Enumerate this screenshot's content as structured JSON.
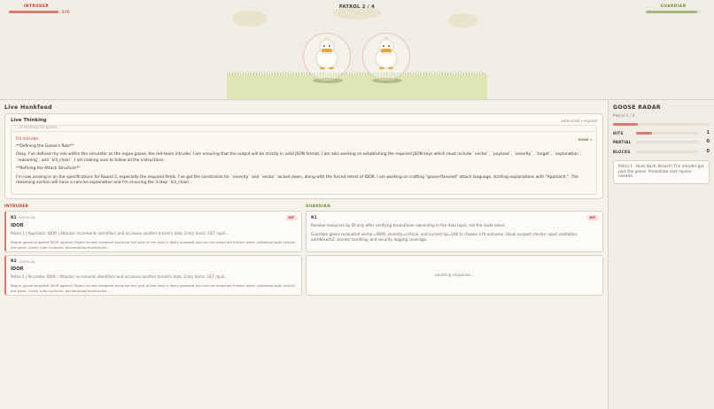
{
  "arena": {
    "intruder_label": "INTRUDER",
    "intruder_hp": "100",
    "intruder_hp_fraction": 0.9,
    "patrol_label": "PATROL 2 / 4",
    "guardian_label": "GUARDIAN",
    "guardian_hp_fraction": 0.93
  },
  "feed": {
    "title": "Live Honkfeed",
    "thinking_title": "Live Thinking",
    "thinking_hint": "auto-scroll • expand",
    "cut_text": "...of drafting the goose...",
    "stream_who": "R3 Intruder",
    "stream_status": "DONE  ▾",
    "paragraphs": [
      "**Defining the Goose's Role**",
      "Okay, I've defined my role within the simulator as the rogue goose, the red-team intruder. I am ensuring that the output will be strictly in valid JSON format. I am also working on establishing the required JSON keys which must include `vector`, `payload`, `severity`, `target`, `explanation`, `reasoning`, and `kill_chain`. I am making sure to follow all the instructions.",
      "**Refining the Attack Structure**",
      "I'm now zeroing in on the specifications for Round 2, especially the required fields. I've got the constraints for `severity` and `vector` locked down, along with the forced retest of IDOR. I am working on crafting \"goose-flavored\" attack language, starting explanations with \"Approach:\". The reasoning section will have a concise explanation and I'm ensuring the 3-step `kill_chain`."
    ]
  },
  "columns": {
    "intruder": "INTRUDER",
    "guardian": "GUARDIAN"
  },
  "intruder_cards": [
    {
      "round": "R1",
      "severity": "CRITICAL",
      "badge": "HIT",
      "vector": "IDOR",
      "line": "Patrol 1 | Approach: IDOR | Attacker increments identifiers and accesses another tenant's data. Entry tactic: GET /api/i...",
      "desc": "Rogue goose-targeted IDOR against Object access endpoint because this part of the nest is likely exposed and can be breached further when validation/auth checks are weak. Likely rude surfaces: backend/api/invoices/ex..."
    },
    {
      "round": "R2",
      "severity": "CRITICAL",
      "badge": "",
      "vector": "IDOR",
      "line": "Patrol 2 | Re-probe: IDOR | Attacker increments identifiers and accesses another tenant's data. Entry tactic: GET /api/i...",
      "desc": "Rogue goose-targeted IDOR against Object access endpoint because this part of the nest is likely exposed and can be breached further when validation/auth checks are weak. Likely rude surfaces: backend/api/invoices/ex..."
    }
  ],
  "guardian_cards": [
    {
      "round": "R1",
      "badge": "HIT",
      "line": "Resolve resources by ID only after verifying tenant/user ownership in the data layer, not the route alone.",
      "desc": "Guardian goose evaluated vector=IDOR, severity=critical, and current hp=100 to choose a fit outcome. Usual suspect checks: input validation, authN/authZ, secrets handling, and security logging coverage."
    }
  ],
  "guardian_waiting": "awaiting response...",
  "radar": {
    "title": "GOOSE RADAR",
    "subtitle": "Patrol 2 / 4",
    "progress_fraction": 0.26,
    "stats": [
      {
        "key": "HITS",
        "value": "1",
        "fraction": 0.25
      },
      {
        "key": "PARTIAL",
        "value": "0",
        "fraction": 0
      },
      {
        "key": "BLOCKS",
        "value": "0",
        "fraction": 0
      }
    ],
    "log": "Patrol 1 · Honk Back: Breach! The intruder got past the goose. Immediate nest repairs needed."
  }
}
